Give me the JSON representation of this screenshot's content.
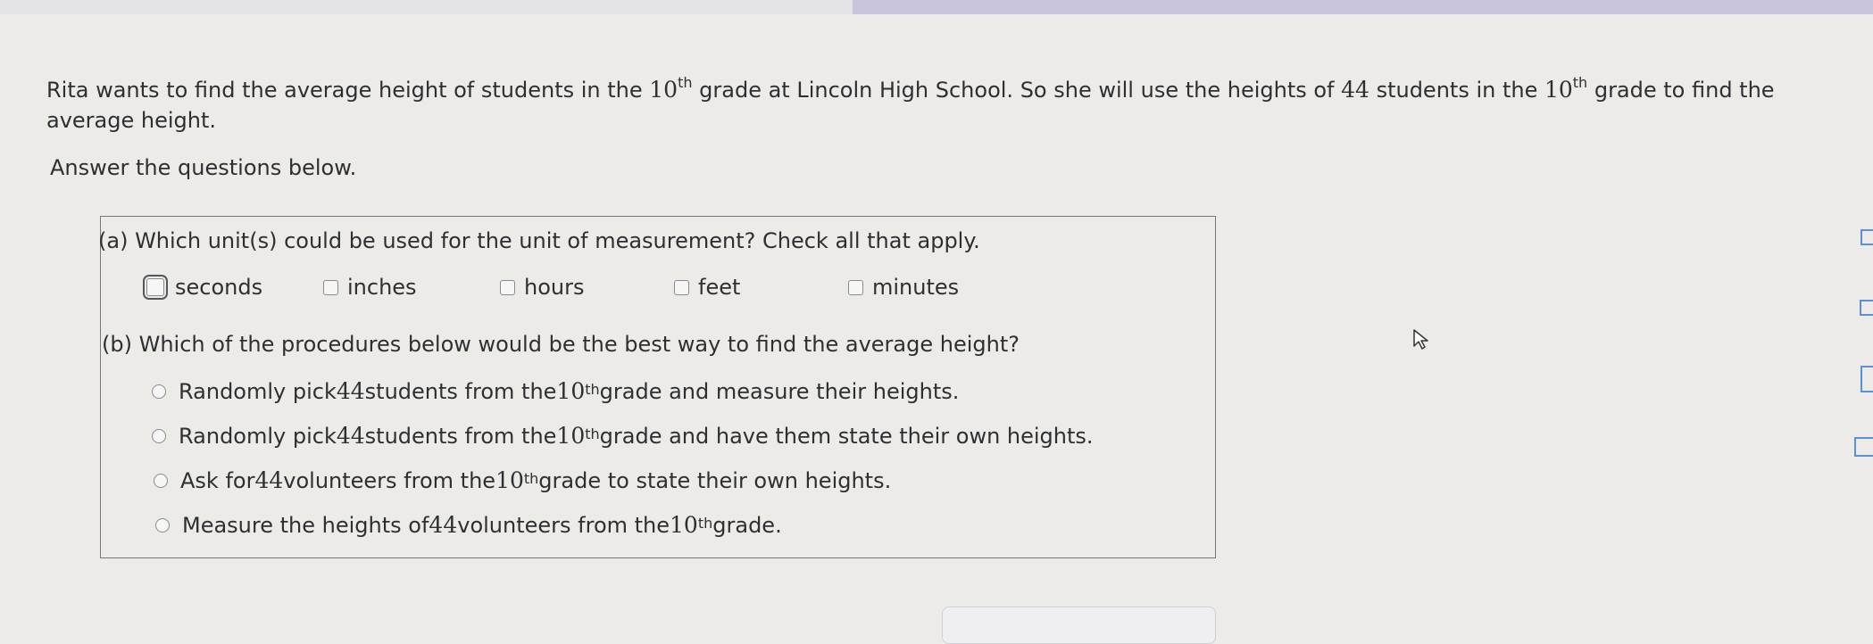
{
  "problem": {
    "p1": "Rita wants to find the average height of students in the ",
    "grade_num": "10",
    "sup": "th",
    "p2": " grade at Lincoln High School. So she will use the heights of ",
    "count": "44",
    "p3": " students in the ",
    "p4": " grade to find the",
    "p5": "average height."
  },
  "instructions": "Answer the questions below.",
  "part_a": {
    "question": "(a)  Which unit(s) could be used for the unit of measurement? Check all that apply.",
    "options": [
      {
        "label": "seconds",
        "checked": false
      },
      {
        "label": "inches",
        "checked": false
      },
      {
        "label": "hours",
        "checked": false
      },
      {
        "label": "feet",
        "checked": false
      },
      {
        "label": "minutes",
        "checked": false
      }
    ]
  },
  "part_b": {
    "question": "(b)  Which of the procedures below would be the best way to find the average height?",
    "sup": "th",
    "options": [
      {
        "pre": "Randomly pick ",
        "count": "44",
        "mid": " students from the ",
        "grade": "10",
        "post": " grade and measure their heights."
      },
      {
        "pre": "Randomly pick ",
        "count": "44",
        "mid": " students from the ",
        "grade": "10",
        "post": " grade and have them state their own heights."
      },
      {
        "pre": "Ask for ",
        "count": "44",
        "mid": " volunteers from the ",
        "grade": "10",
        "post": " grade to state their own heights."
      },
      {
        "pre": "Measure the heights of ",
        "count": "44",
        "mid": " volunteers from the ",
        "grade": "10",
        "post": " grade."
      }
    ]
  }
}
